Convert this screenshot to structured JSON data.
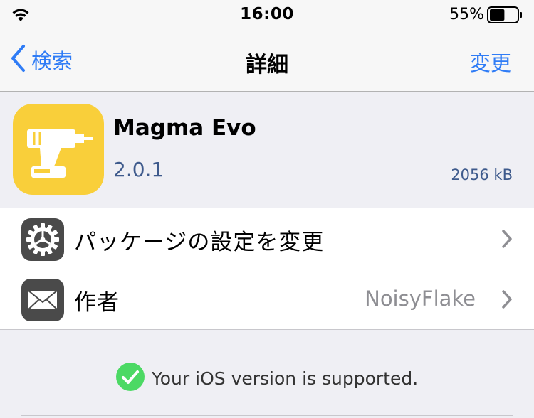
{
  "status_bar": {
    "wifi_icon": "wifi-icon",
    "time": "16:00",
    "battery_percent": "55%",
    "battery_level": 0.55
  },
  "nav": {
    "back_label": "検索",
    "title": "詳細",
    "action_label": "変更"
  },
  "package": {
    "icon": "drill-icon",
    "name": "Magma Evo",
    "version": "2.0.1",
    "size": "2056 kB"
  },
  "rows": [
    {
      "icon": "gear-icon",
      "label": "パッケージの設定を変更",
      "detail": ""
    },
    {
      "icon": "envelope-icon",
      "label": "作者",
      "detail": "NoisyFlake"
    }
  ],
  "support": {
    "icon": "checkmark-circle-icon",
    "text": "Your iOS version is supported.",
    "status_color": "#4cd964"
  },
  "colors": {
    "accent": "#2f7cf6",
    "icon_background": "#f9cf3a",
    "secondary_text": "#3e5a8c"
  }
}
